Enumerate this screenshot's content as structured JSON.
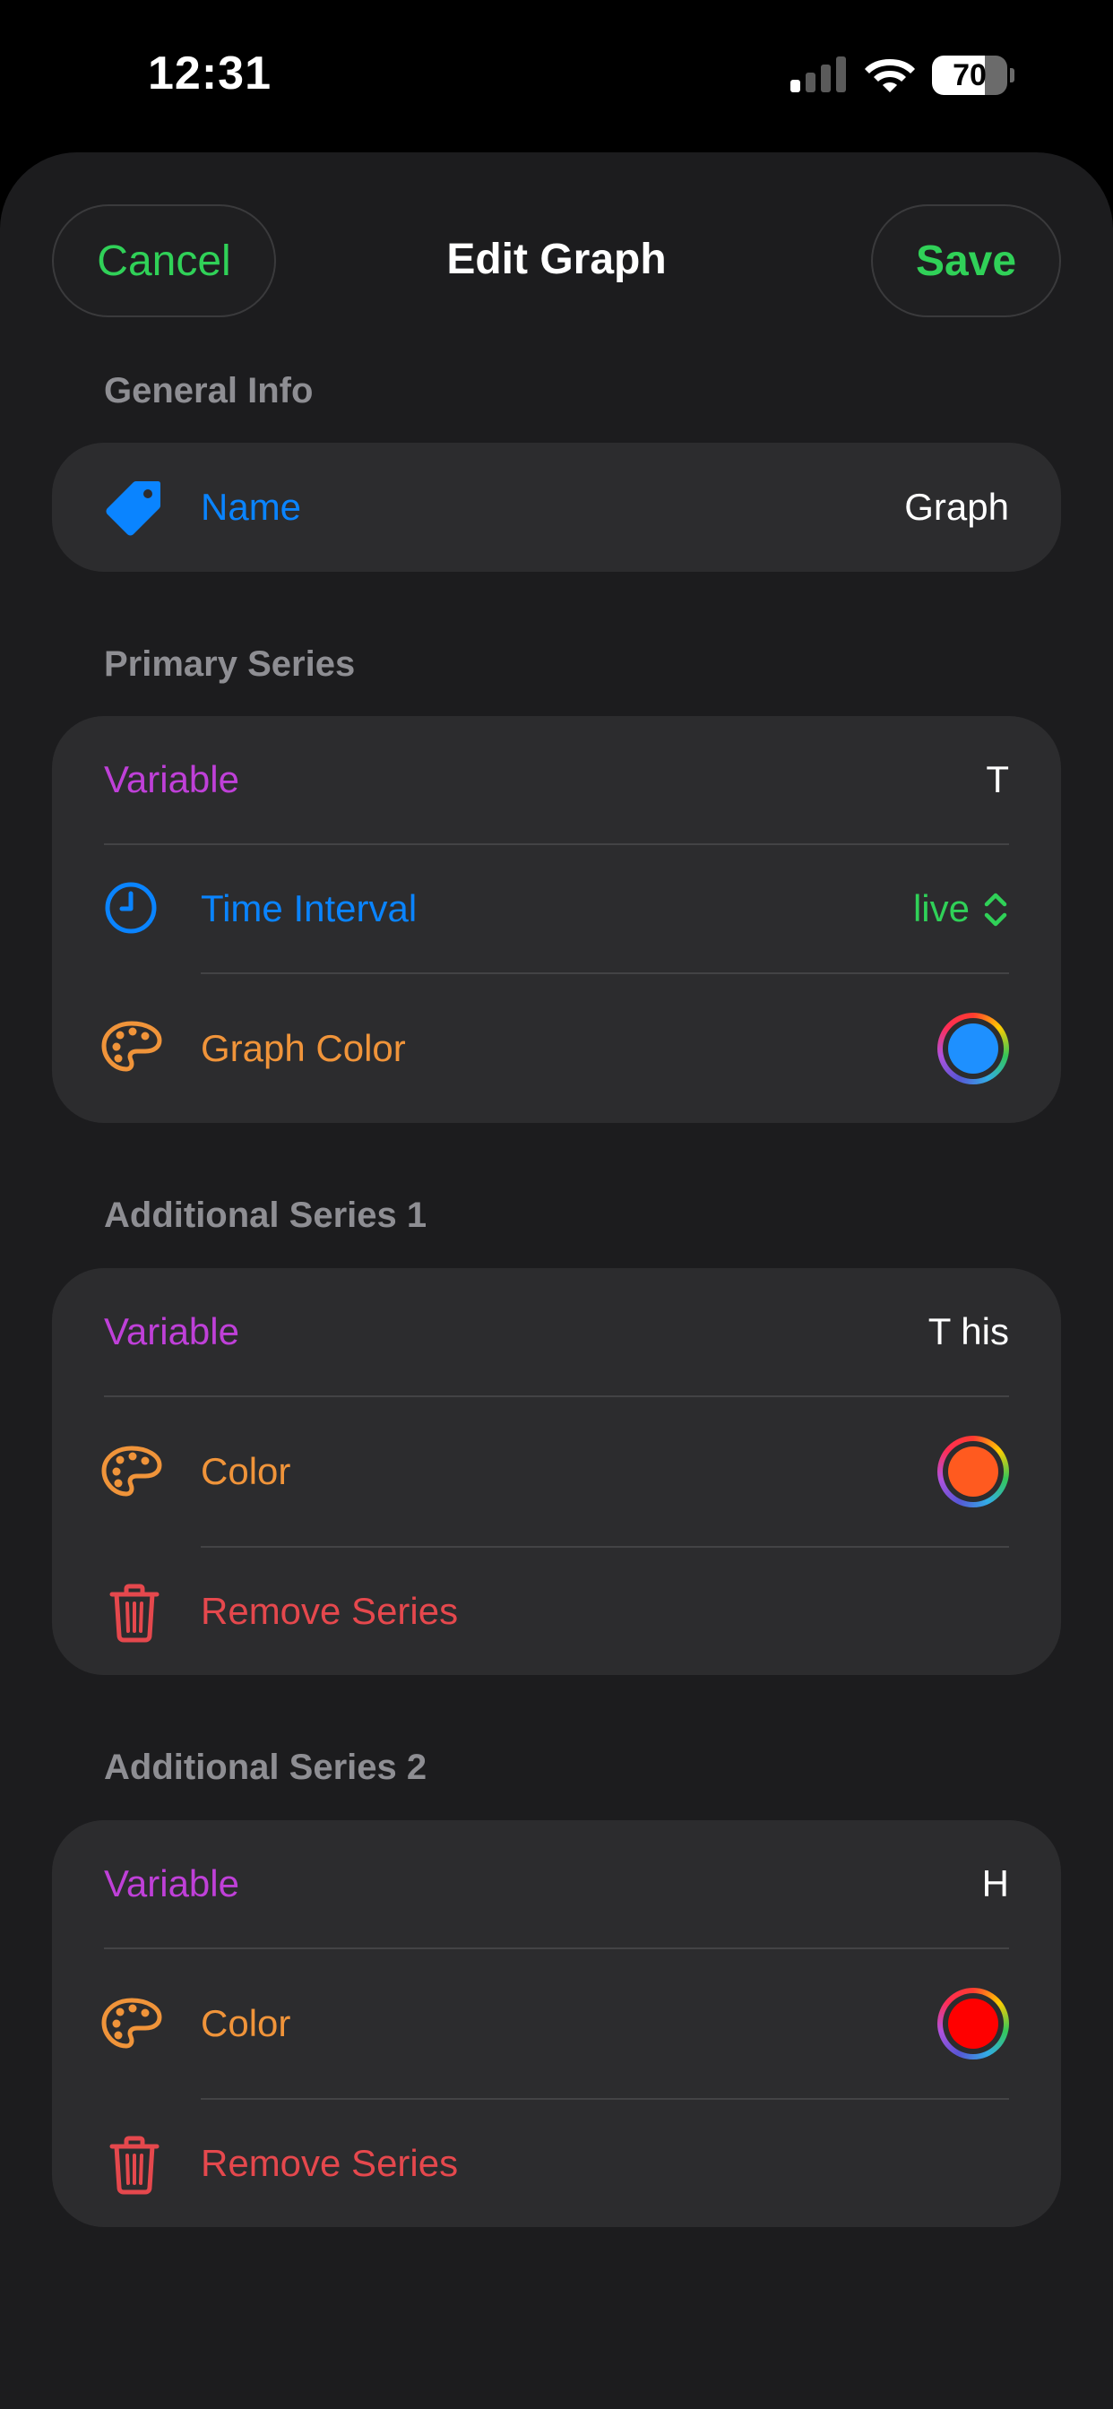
{
  "status_bar": {
    "time": "12:31",
    "battery_percent": "70",
    "battery_level": 0.7,
    "signal_bars_active": 1,
    "signal_bars_total": 4
  },
  "nav": {
    "cancel_label": "Cancel",
    "title": "Edit Graph",
    "save_label": "Save"
  },
  "general_info": {
    "header": "General Info",
    "name_label": "Name",
    "name_value": "Graph"
  },
  "primary_series": {
    "header": "Primary Series",
    "variable_label": "Variable",
    "variable_value": "T",
    "time_interval_label": "Time Interval",
    "time_interval_value": "live",
    "graph_color_label": "Graph Color",
    "graph_color": "#1e90ff"
  },
  "additional_series": [
    {
      "header": "Additional Series 1",
      "variable_label": "Variable",
      "variable_value": "T his",
      "color_label": "Color",
      "color": "#ff5a1f",
      "remove_label": "Remove Series"
    },
    {
      "header": "Additional Series 2",
      "variable_label": "Variable",
      "variable_value": "H",
      "color_label": "Color",
      "color": "#ff0000",
      "remove_label": "Remove Series"
    }
  ],
  "colors": {
    "accent_green": "#30d158",
    "label_blue": "#0a84ff",
    "label_purple": "#bf40d8",
    "label_orange": "#f0943a",
    "label_red": "#e5484d"
  },
  "icons": {
    "name": "tag-icon",
    "time_interval": "clock-icon",
    "color": "palette-icon",
    "remove": "trash-icon",
    "stepper": "chevron-up-down-icon"
  }
}
